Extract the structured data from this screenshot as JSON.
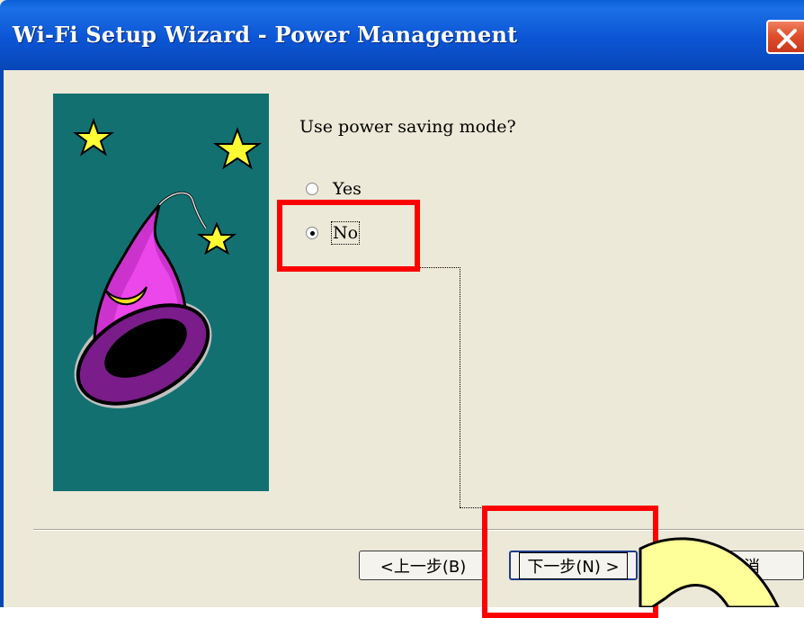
{
  "window": {
    "title": "Wi-Fi Setup Wizard - Power Management"
  },
  "content": {
    "question": "Use power saving mode?",
    "options": [
      {
        "label": "Yes",
        "selected": false
      },
      {
        "label": "No",
        "selected": true
      }
    ]
  },
  "buttons": {
    "back": "<上一步(B)",
    "next": "下一步(N) >",
    "cancel": "消"
  },
  "colors": {
    "titlebar": "#0a55d4",
    "art_background": "#137070",
    "highlight": "#ff0000",
    "callout_fill": "#ffff99"
  },
  "icons": {
    "close": "close-icon",
    "art": "wizard-hat-illustration"
  }
}
